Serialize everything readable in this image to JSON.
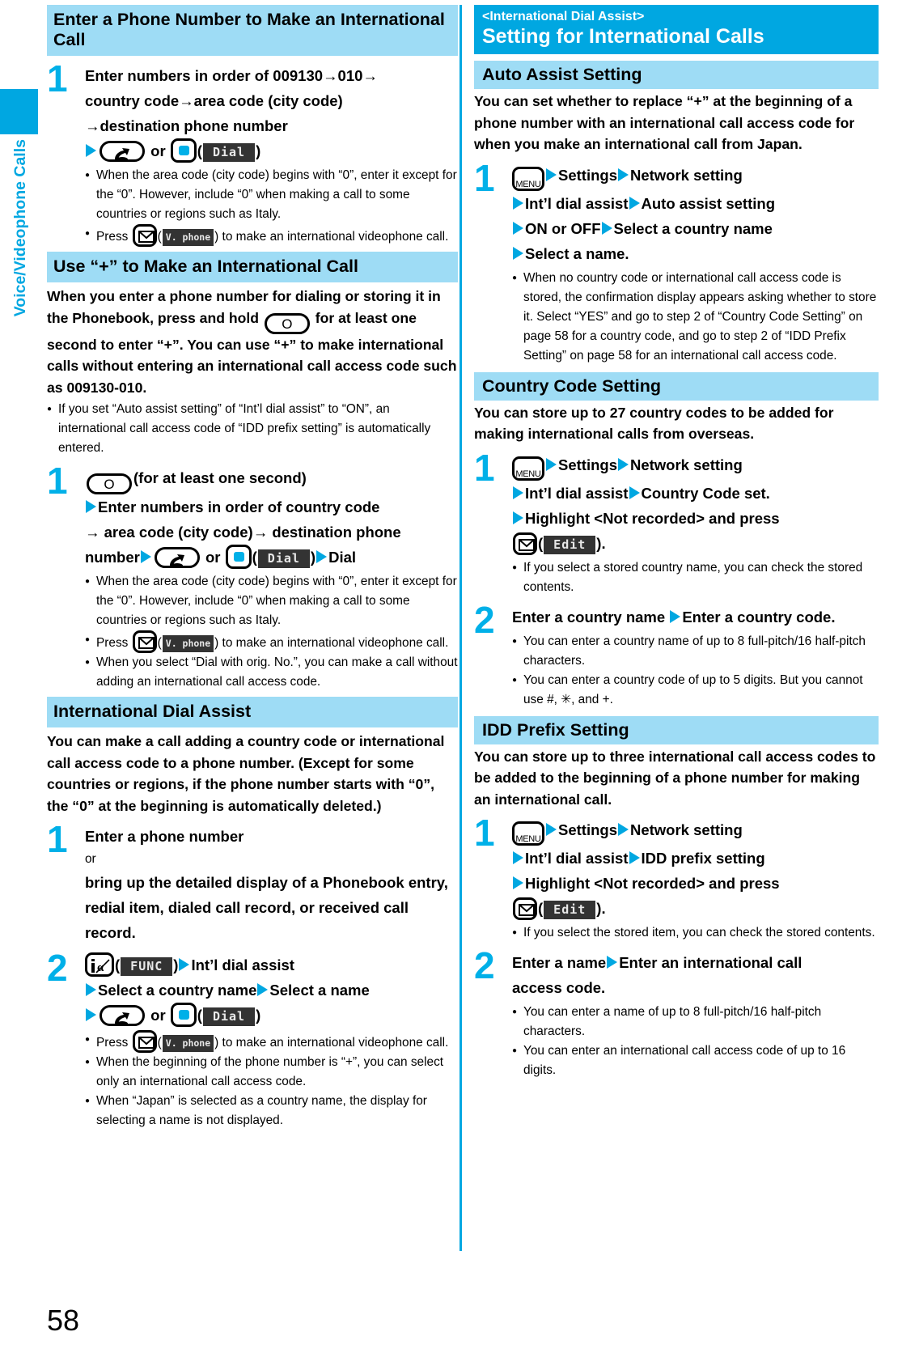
{
  "sidebar": {
    "chapter_label": "Voice/Videophone Calls"
  },
  "page_number": "58",
  "left_column": {
    "section1": {
      "title": "Enter a Phone Number to Make an International Call",
      "step1": {
        "num": "1",
        "line1_a": "Enter numbers in order of 009130",
        "line1_arrow1": "→",
        "line1_b": "010",
        "line1_arrow2": "→",
        "line2_a": "country code",
        "line2_arrow": "→",
        "line2_b": "area code (city code)",
        "line3_arrow": "→",
        "line3_a": "destination phone number",
        "line4_or": "or",
        "line4_softkey": "Dial",
        "notes": [
          "When the area code (city code) begins with “0”, enter it except for the “0”. However, include “0” when making a call to some countries or regions such as Italy.",
          "Press ( ) to make an international videophone call."
        ],
        "note2_pre": "Press",
        "note2_softkey": "V. phone",
        "note2_post": ") to make an international videophone call."
      }
    },
    "section2": {
      "title": "Use “+” to Make an International Call",
      "lead_a": "When you enter a phone number for dialing or storing it in the Phonebook, press and hold",
      "key_glyph": "O",
      "lead_b": "for at least one second to enter “+”. You can use “+” to make international calls without entering an international call access code such as 009130-010.",
      "notes": [
        "If you set “Auto assist setting” of “Int’l dial assist” to “ON”, an international call access code of “IDD prefix setting” is automatically entered."
      ],
      "step1": {
        "num": "1",
        "key_glyph": "O",
        "line1_post": "(for at least one second)",
        "line2": "Enter numbers in order of country code",
        "line3_arrow": "→",
        "line3_a": "area code (city code)",
        "line3_arrow2": "→",
        "line3_b": "destination phone",
        "line4_a": "number",
        "line4_or": "or",
        "line4_softkey": "Dial",
        "line4_b": "Dial",
        "notes": [
          "When the area code (city code) begins with “0”, enter it except for the “0”. However, include “0” when making a call to some countries or regions such as Italy.",
          "Press ( ) to make an international videophone call.",
          "When you select “Dial with orig. No.”, you can make a call without adding an international call access code."
        ],
        "note2_pre": "Press",
        "note2_softkey": "V. phone",
        "note2_post": ") to make an international videophone call.",
        "note3": "When you select “Dial with orig. No.”, you can make a call without adding an international call access code."
      }
    },
    "section3": {
      "title": "International Dial Assist",
      "lead": "You can make a call adding a country code or international call access code to a phone number. (Except for some countries or regions, if the phone number starts with “0”, the “0” at the beginning is automatically deleted.)",
      "step1": {
        "num": "1",
        "line1": "Enter a phone number",
        "line2": "or",
        "line3": "bring up the detailed display of a Phonebook entry, redial item, dialed call record, or received call record."
      },
      "step2": {
        "num": "2",
        "softkey1": "FUNC",
        "line1_post": "Int’l dial assist",
        "line2_a": "Select a country name",
        "line2_b": "Select a name",
        "line3_or": "or",
        "line3_softkey": "Dial",
        "notes": [
          "Press ( ) to make an international videophone call.",
          "When the beginning of the phone number is “+”, you can select only an international call access code.",
          "When “Japan” is selected as a country name, the display for selecting a name is not displayed."
        ],
        "note1_pre": "Press",
        "note1_softkey": "V. phone",
        "note1_post": ") to make an international videophone call.",
        "note2": "When the beginning of the phone number is “+”, you can select only an international call access code.",
        "note3": "When “Japan” is selected as a country name, the display for selecting a name is not displayed."
      }
    }
  },
  "right_column": {
    "chapter": {
      "sub": "<International Dial Assist>",
      "main": "Setting for International Calls"
    },
    "section1": {
      "title": "Auto Assist Setting",
      "lead": "You can set whether to replace “+” at the beginning of a phone number with an international call access code for when you make an international call from Japan.",
      "step1": {
        "num": "1",
        "key": "MENU",
        "line1_a": "Settings",
        "line1_b": "Network setting",
        "line2_a": "Int’l dial assist",
        "line2_b": "Auto assist setting",
        "line3_a": "ON or OFF",
        "line3_b": "Select a country name",
        "line4": "Select a name.",
        "notes": [
          "When no country code or international call access code is stored, the confirmation display appears asking whether to store it. Select “YES” and go to step 2 of “Country Code Setting” on page 58 for a country code, and go to step 2 of “IDD Prefix Setting” on page 58 for an international call access code."
        ]
      }
    },
    "section2": {
      "title": "Country Code Setting",
      "lead": "You can store up to 27 country codes to be added for making international calls from overseas.",
      "step1": {
        "num": "1",
        "key": "MENU",
        "line1_a": "Settings",
        "line1_b": "Network setting",
        "line2_a": "Int’l dial assist",
        "line2_b": "Country Code set.",
        "line3": "Highlight <Not recorded> and press",
        "line4_softkey": "Edit",
        "line4_post": ").",
        "notes": [
          "If you select a stored country name, you can check the stored contents."
        ]
      },
      "step2": {
        "num": "2",
        "line1_a": "Enter a country name",
        "line1_b": "Enter a country code.",
        "notes": [
          "You can enter a country name of up to 8 full-pitch/16 half-pitch characters.",
          "You can enter a country code of up to 5 digits. But you cannot use #, ✳, and +."
        ],
        "note2_a": "You can enter a country code of up to 5 digits. But you cannot use #, ",
        "note2_star": "✳",
        "note2_b": ", and +."
      }
    },
    "section3": {
      "title": "IDD Prefix Setting",
      "lead": "You can store up to three international call access codes to be added to the beginning of a phone number for making an international call.",
      "step1": {
        "num": "1",
        "key": "MENU",
        "line1_a": "Settings",
        "line1_b": "Network setting",
        "line2_a": "Int’l dial assist",
        "line2_b": "IDD prefix setting",
        "line3": "Highlight <Not recorded> and press",
        "line4_softkey": "Edit",
        "line4_post": ").",
        "notes": [
          "If you select the stored item, you can check the stored contents."
        ]
      },
      "step2": {
        "num": "2",
        "line1_a": "Enter a name",
        "line1_b": "Enter an international call",
        "line2": "access code.",
        "notes": [
          "You can enter a name of up to 8 full-pitch/16 half-pitch characters.",
          "You can enter an international call access code of up to 16 digits."
        ]
      }
    }
  },
  "colors": {
    "accent": "#00a7e1",
    "heading_bg": "#9edcf5",
    "step_number": "#00b0e8",
    "softkey_bg": "#333333"
  }
}
